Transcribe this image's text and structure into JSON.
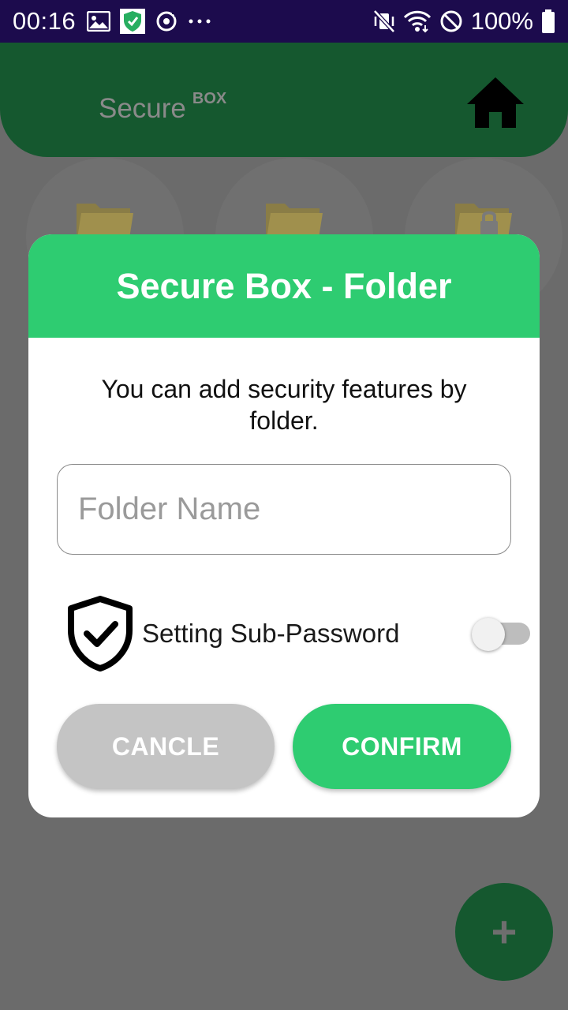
{
  "status_bar": {
    "time": "00:16",
    "battery": "100%",
    "left_icons": [
      "image-icon",
      "app-shield-icon",
      "sync-icon",
      "more-dots-icon"
    ],
    "right_icons": [
      "vibrate-mute-icon",
      "wifi-icon",
      "do-not-disturb-icon",
      "battery-icon"
    ]
  },
  "header": {
    "title": "Secure",
    "title_sup": "BOX",
    "home_icon": "home-icon"
  },
  "background_folders": [
    {
      "icon": "folder-icon"
    },
    {
      "icon": "folder-icon"
    },
    {
      "icon": "locked-folder-icon"
    }
  ],
  "fab": {
    "label": "+"
  },
  "dialog": {
    "title": "Secure Box - Folder",
    "description": "You can add security features by folder.",
    "folder_name_placeholder": "Folder Name",
    "folder_name_value": "",
    "sub_password_label": "Setting Sub-Password",
    "sub_password_enabled": false,
    "cancel_label": "CANCLE",
    "confirm_label": "CONFIRM"
  },
  "colors": {
    "accent_green": "#2ecc71",
    "header_green": "#15582f",
    "status_bar": "#1c0b4d",
    "overlay": "#6b6b6b"
  }
}
